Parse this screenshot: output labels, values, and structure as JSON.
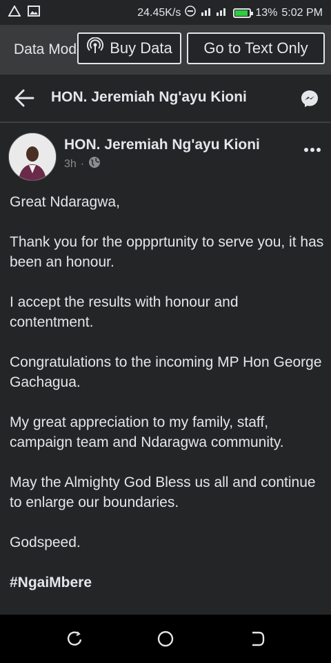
{
  "status": {
    "speed": "24.45K/s",
    "battery": "13%",
    "time": "5:02 PM",
    "battery_level": 0.13
  },
  "databar": {
    "mode_label": "Data Mode",
    "buy_label": "Buy Data",
    "text_only_label": "Go to Text Only"
  },
  "nav": {
    "title": "HON. Jeremiah Ng'ayu  Kioni"
  },
  "post": {
    "author": "HON. Jeremiah Ng'ayu  Kioni",
    "time": "3h",
    "dot": "·",
    "paragraphs": [
      "Great Ndaragwa,",
      "Thank you for the oppprtunity to serve you, it has been an honour.",
      "I accept the results with honour and contentment.",
      "Congratulations to the incoming MP Hon George Gachagua.",
      "My great appreciation to my family, staff, campaign team and Ndaragwa community.",
      "May the Almighty God Bless us all and continue to enlarge our boundaries.",
      "Godspeed."
    ],
    "hashtag": "#NgaiMbere"
  },
  "icons": {
    "back": "arrow-left-icon",
    "messenger": "messenger-icon",
    "globe": "globe-icon",
    "more": "more-dots-icon",
    "broadcast": "broadcast-icon"
  }
}
